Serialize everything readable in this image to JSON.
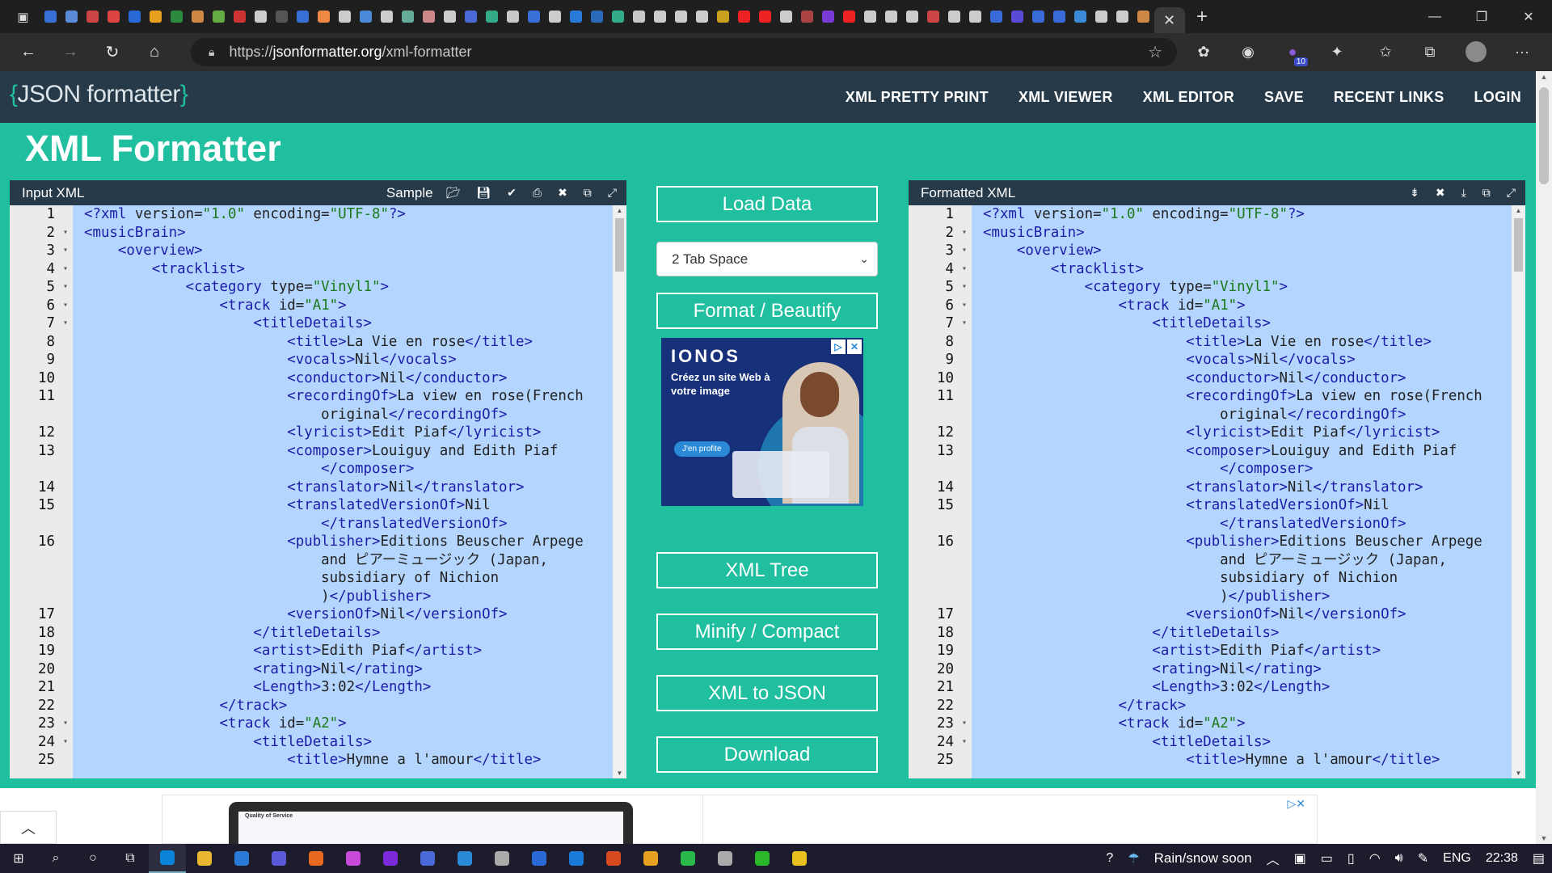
{
  "browser": {
    "url_prefix": "https://",
    "url_host": "jsonformatter.org",
    "url_path": "/xml-formatter",
    "tab_colors": [
      "#3a6fd8",
      "#5a8ad8",
      "#c44",
      "#d44",
      "#2a6ad8",
      "#e8a020",
      "#2b8a3e",
      "#c84",
      "#6a4",
      "#c33",
      "#ccc",
      "#555",
      "#3a6fd8",
      "#e84",
      "#ccc",
      "#4a8ad8",
      "#ccc",
      "#6a9",
      "#c88",
      "#ccc",
      "#4a6ad8",
      "#3a8",
      "#c8c8c8",
      "#3a6fd8",
      "#ccc",
      "#2a7ad8",
      "#2a6ab8",
      "#3a8",
      "#c8c8c8",
      "#ccc",
      "#ccc",
      "#ccc",
      "#c9a020",
      "#e22",
      "#e22",
      "#ccc",
      "#a44",
      "#7a3ad8",
      "#e22",
      "#ccc",
      "#ccc",
      "#ccc",
      "#c44",
      "#ccc",
      "#ccc",
      "#3a6ad8",
      "#5a4ad8",
      "#3a6ad8",
      "#3a6ad8",
      "#3a8ad8",
      "#ccc",
      "#ccc",
      "#c84"
    ],
    "extension_badge": "10",
    "window_controls": [
      "—",
      "❐",
      "✕"
    ]
  },
  "site": {
    "logo": {
      "open": "{",
      "text": "JSON formatter",
      "close": "}"
    },
    "nav": [
      "XML PRETTY PRINT",
      "XML VIEWER",
      "XML EDITOR",
      "SAVE",
      "RECENT LINKS",
      "LOGIN"
    ],
    "page_title": "XML Formatter"
  },
  "input_panel": {
    "title": "Input XML",
    "sample_label": "Sample"
  },
  "output_panel": {
    "title": "Formatted XML"
  },
  "middle": {
    "load_data": "Load Data",
    "indent_select": "2 Tab Space",
    "format": "Format / Beautify",
    "xml_tree": "XML Tree",
    "minify": "Minify / Compact",
    "xml_to_json": "XML to JSON",
    "download": "Download"
  },
  "ad": {
    "brand": "IONOS",
    "tagline": "Créez un site Web à votre image",
    "cta": "J'en profite"
  },
  "bottom_ad": {
    "screen_title": "Quality of Service"
  },
  "code_lines": [
    {
      "n": "1",
      "fold": false,
      "indent": 0,
      "parts": [
        [
          "pi",
          "<?xml"
        ],
        [
          "attr",
          " version="
        ],
        [
          "aval",
          "\"1.0\""
        ],
        [
          "attr",
          " encoding="
        ],
        [
          "aval",
          "\"UTF-8\""
        ],
        [
          "pi",
          "?>"
        ]
      ]
    },
    {
      "n": "2",
      "fold": true,
      "indent": 0,
      "parts": [
        [
          "tag",
          "<musicBrain>"
        ]
      ]
    },
    {
      "n": "3",
      "fold": true,
      "indent": 1,
      "parts": [
        [
          "tag",
          "<overview>"
        ]
      ]
    },
    {
      "n": "4",
      "fold": true,
      "indent": 2,
      "parts": [
        [
          "tag",
          "<tracklist>"
        ]
      ]
    },
    {
      "n": "5",
      "fold": true,
      "indent": 3,
      "parts": [
        [
          "tag",
          "<category"
        ],
        [
          "attr",
          " type="
        ],
        [
          "aval",
          "\"Vinyl1\""
        ],
        [
          "tag",
          ">"
        ]
      ]
    },
    {
      "n": "6",
      "fold": true,
      "indent": 4,
      "parts": [
        [
          "tag",
          "<track"
        ],
        [
          "attr",
          " id="
        ],
        [
          "aval",
          "\"A1\""
        ],
        [
          "tag",
          ">"
        ]
      ]
    },
    {
      "n": "7",
      "fold": true,
      "indent": 5,
      "parts": [
        [
          "tag",
          "<titleDetails>"
        ]
      ]
    },
    {
      "n": "8",
      "fold": false,
      "indent": 6,
      "parts": [
        [
          "tag",
          "<title>"
        ],
        [
          "attr",
          "La Vie en rose"
        ],
        [
          "tag",
          "</title>"
        ]
      ]
    },
    {
      "n": "9",
      "fold": false,
      "indent": 6,
      "parts": [
        [
          "tag",
          "<vocals>"
        ],
        [
          "attr",
          "Nil"
        ],
        [
          "tag",
          "</vocals>"
        ]
      ]
    },
    {
      "n": "10",
      "fold": false,
      "indent": 6,
      "parts": [
        [
          "tag",
          "<conductor>"
        ],
        [
          "attr",
          "Nil"
        ],
        [
          "tag",
          "</conductor>"
        ]
      ]
    },
    {
      "n": "11",
      "fold": false,
      "indent": 6,
      "parts": [
        [
          "tag",
          "<recordingOf>"
        ],
        [
          "attr",
          "La view en rose(French"
        ]
      ]
    },
    {
      "n": "",
      "fold": false,
      "indent": 7,
      "parts": [
        [
          "attr",
          "original"
        ],
        [
          "tag",
          "</recordingOf>"
        ]
      ]
    },
    {
      "n": "12",
      "fold": false,
      "indent": 6,
      "parts": [
        [
          "tag",
          "<lyricist>"
        ],
        [
          "attr",
          "Edit Piaf"
        ],
        [
          "tag",
          "</lyricist>"
        ]
      ]
    },
    {
      "n": "13",
      "fold": false,
      "indent": 6,
      "parts": [
        [
          "tag",
          "<composer>"
        ],
        [
          "attr",
          "Louiguy and Edith Piaf"
        ]
      ]
    },
    {
      "n": "",
      "fold": false,
      "indent": 7,
      "parts": [
        [
          "tag",
          "</composer>"
        ]
      ]
    },
    {
      "n": "14",
      "fold": false,
      "indent": 6,
      "parts": [
        [
          "tag",
          "<translator>"
        ],
        [
          "attr",
          "Nil"
        ],
        [
          "tag",
          "</translator>"
        ]
      ]
    },
    {
      "n": "15",
      "fold": false,
      "indent": 6,
      "parts": [
        [
          "tag",
          "<translatedVersionOf>"
        ],
        [
          "attr",
          "Nil"
        ]
      ]
    },
    {
      "n": "",
      "fold": false,
      "indent": 7,
      "parts": [
        [
          "tag",
          "</translatedVersionOf>"
        ]
      ]
    },
    {
      "n": "16",
      "fold": false,
      "indent": 6,
      "parts": [
        [
          "tag",
          "<publisher>"
        ],
        [
          "attr",
          "Editions Beuscher Arpege"
        ]
      ]
    },
    {
      "n": "",
      "fold": false,
      "indent": 7,
      "parts": [
        [
          "attr",
          "and ピアーミュージック (Japan,"
        ]
      ]
    },
    {
      "n": "",
      "fold": false,
      "indent": 7,
      "parts": [
        [
          "attr",
          "subsidiary of Nichion"
        ]
      ]
    },
    {
      "n": "",
      "fold": false,
      "indent": 7,
      "parts": [
        [
          "attr",
          ")"
        ],
        [
          "tag",
          "</publisher>"
        ]
      ]
    },
    {
      "n": "17",
      "fold": false,
      "indent": 6,
      "parts": [
        [
          "tag",
          "<versionOf>"
        ],
        [
          "attr",
          "Nil"
        ],
        [
          "tag",
          "</versionOf>"
        ]
      ]
    },
    {
      "n": "18",
      "fold": false,
      "indent": 5,
      "parts": [
        [
          "tag",
          "</titleDetails>"
        ]
      ]
    },
    {
      "n": "19",
      "fold": false,
      "indent": 5,
      "parts": [
        [
          "tag",
          "<artist>"
        ],
        [
          "attr",
          "Edith Piaf"
        ],
        [
          "tag",
          "</artist>"
        ]
      ]
    },
    {
      "n": "20",
      "fold": false,
      "indent": 5,
      "parts": [
        [
          "tag",
          "<rating>"
        ],
        [
          "attr",
          "Nil"
        ],
        [
          "tag",
          "</rating>"
        ]
      ]
    },
    {
      "n": "21",
      "fold": false,
      "indent": 5,
      "parts": [
        [
          "tag",
          "<Length>"
        ],
        [
          "attr",
          "3:02"
        ],
        [
          "tag",
          "</Length>"
        ]
      ]
    },
    {
      "n": "22",
      "fold": false,
      "indent": 4,
      "parts": [
        [
          "tag",
          "</track>"
        ]
      ]
    },
    {
      "n": "23",
      "fold": true,
      "indent": 4,
      "parts": [
        [
          "tag",
          "<track"
        ],
        [
          "attr",
          " id="
        ],
        [
          "aval",
          "\"A2\""
        ],
        [
          "tag",
          ">"
        ]
      ]
    },
    {
      "n": "24",
      "fold": true,
      "indent": 5,
      "parts": [
        [
          "tag",
          "<titleDetails>"
        ]
      ]
    },
    {
      "n": "25",
      "fold": false,
      "indent": 6,
      "parts": [
        [
          "tag",
          "<title>"
        ],
        [
          "attr",
          "Hymne a l'amour"
        ],
        [
          "tag",
          "</title>"
        ]
      ]
    }
  ],
  "taskbar": {
    "weather": "Rain/snow soon",
    "lang": "ENG",
    "time": "22:38",
    "icon_colors": [
      "#0a84d8",
      "#e8b830",
      "#2a7ad8",
      "#5a5ad8",
      "#e86a20",
      "#c84ad8",
      "#7a2ad8",
      "#4a6ad8",
      "#2a8ad8",
      "#aaa",
      "#2a6ad8",
      "#1a7ad8",
      "#d84a20",
      "#e8a020",
      "#2ab84a",
      "#aaa",
      "#2ab82a",
      "#e8c020"
    ]
  }
}
